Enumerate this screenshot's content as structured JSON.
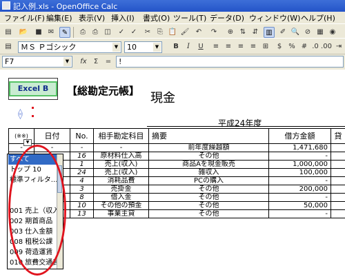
{
  "window": {
    "title": "記入例.xls - OpenOffice Calc"
  },
  "menu": [
    "ファイル(F)",
    "編集(E)",
    "表示(V)",
    "挿入(I)",
    "書式(O)",
    "ツール(T)",
    "データ(D)",
    "ウィンドウ(W)",
    "ヘルプ(H)"
  ],
  "format_toolbar": {
    "font_name": "ＭＳ Ｐゴシック",
    "font_size": "10"
  },
  "formula_bar": {
    "cell_ref": "F7",
    "content": "!"
  },
  "sheet": {
    "badge": "Excel B",
    "header_title": "【総勘定元帳】",
    "account_title": "現金",
    "year_title": "平成24年度",
    "columns": [
      "(※※)",
      "日付",
      "No.",
      "相手勘定科目",
      "摘要",
      "借方金額",
      "貸"
    ],
    "rows": [
      {
        "a": "-",
        "date": "-",
        "no": "-",
        "account": "-",
        "desc": "前年度繰越額",
        "debit": "1,471,680"
      },
      {
        "a": "",
        "date": "",
        "no": "16",
        "account": "原材料仕入高",
        "desc": "その他",
        "debit": "-"
      },
      {
        "a": "",
        "date": "",
        "no": "1",
        "account": "売上(収入)",
        "desc": "商品Aを現金販売",
        "debit": "1,000,000"
      },
      {
        "a": "",
        "date": "",
        "no": "24",
        "account": "売上(収入)",
        "desc": "雑収入",
        "debit": "100,000"
      },
      {
        "a": "",
        "date": "",
        "no": "4",
        "account": "消耗品費",
        "desc": "PCの購入",
        "debit": "-"
      },
      {
        "a": "",
        "date": "",
        "no": "3",
        "account": "売掛金",
        "desc": "その他",
        "debit": "200,000"
      },
      {
        "a": "",
        "date": "",
        "no": "8",
        "account": "借入金",
        "desc": "その他",
        "debit": "-"
      },
      {
        "a": "",
        "date": "",
        "no": "10",
        "account": "その他の預金",
        "desc": "その他",
        "debit": "50,000"
      },
      {
        "a": "",
        "date": "",
        "no": "13",
        "account": "事業主貸",
        "desc": "その他",
        "debit": "-"
      }
    ]
  },
  "filter_list": {
    "items": [
      "すべて",
      "トップ 10",
      "標準フィルタ...",
      "-",
      "",
      "001 売上（収入",
      "002 期首商品（",
      "003 仕入金額（",
      "008 租税公課",
      "009 荷造運賃",
      "010 旅費交通費"
    ],
    "selected_index": 0
  },
  "colors": {
    "title_bar": "#2454c8",
    "menu_bg": "#ece9d8",
    "selection": "#316ac5",
    "annotation_oval": "#e0141e",
    "badge_border": "#54c264"
  }
}
